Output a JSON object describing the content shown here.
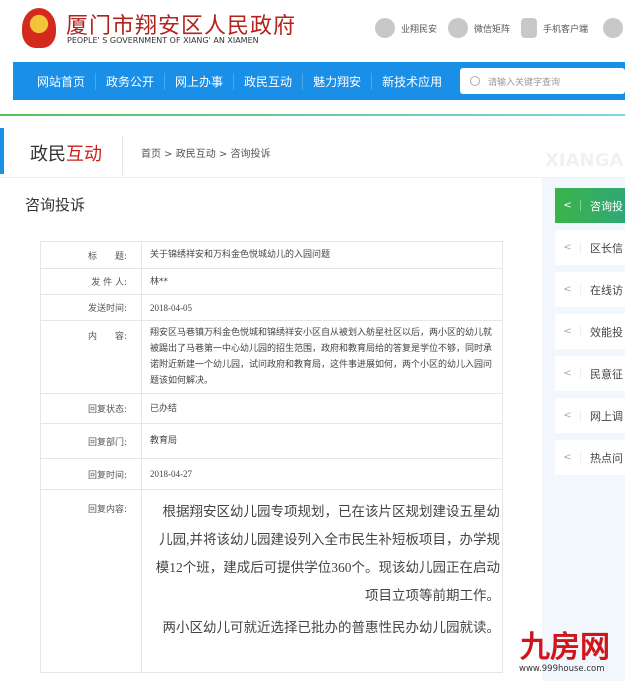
{
  "header": {
    "title": "厦门市翔安区人民政府",
    "subtitle": "PEOPLE' S GOVERNMENT OF XIANG' AN XIAMEN",
    "links": [
      {
        "label": "业翔民安",
        "icon": "chat-icon"
      },
      {
        "label": "微信矩阵",
        "icon": "wechat-icon"
      },
      {
        "label": "手机客户端",
        "icon": "phone-icon"
      },
      {
        "label": "",
        "icon": "eye-icon"
      }
    ]
  },
  "nav": {
    "items": [
      "网站首页",
      "政务公开",
      "网上办事",
      "政民互动",
      "魅力翔安",
      "新技术应用"
    ],
    "search_placeholder": "请输入关键字查询"
  },
  "section": {
    "title_a": "政民",
    "title_b": "互动",
    "breadcrumb": "首页 > 政民互动 > 咨询投诉",
    "bg_text": "XIANGAN"
  },
  "page_title": "咨询投诉",
  "sidebar": {
    "items": [
      "咨询投",
      "区长信",
      "在线访",
      "效能投",
      "民意征",
      "网上调",
      "热点问"
    ],
    "active": 0,
    "accent": "#3bb34a"
  },
  "detail": {
    "rows": [
      {
        "label": "标　　题:",
        "value": "关于锦绣祥安和万科金色悦城幼儿的入园问题"
      },
      {
        "label": "发 件 人:",
        "value": "林**"
      },
      {
        "label": "发送时间:",
        "value": "2018-04-05"
      },
      {
        "label": "内　　容:",
        "value": "翔安区马巷镇万科金色悦城和锦绣祥安小区自从被划入舫星社区以后，两小区的幼儿就被踢出了马巷第一中心幼儿园的招生范围，政府和教育局给的答复是学位不够，同时承诺附近新建一个幼儿园，试问政府和教育局，这件事进展如何，两个小区的幼儿入园问题该如何解决。"
      },
      {
        "label": "回复状态:",
        "value": "已办结"
      },
      {
        "label": "回复部门:",
        "value": "教育局"
      },
      {
        "label": "回复时间:",
        "value": "2018-04-27"
      }
    ],
    "reply_label": "回复内容:",
    "reply_p1": "根据翔安区幼儿园专项规划，已在该片区规划建设五星幼儿园,并将该幼儿园建设列入全市民生补短板项目，办学规模12个班，建成后可提供学位360个。现该幼儿园正在启动项目立项等前期工作。",
    "reply_p2": "两小区幼儿可就近选择已批办的普惠性民办幼儿园就读。"
  },
  "watermark": {
    "logo": "九房网",
    "url": "www.999house.com"
  }
}
